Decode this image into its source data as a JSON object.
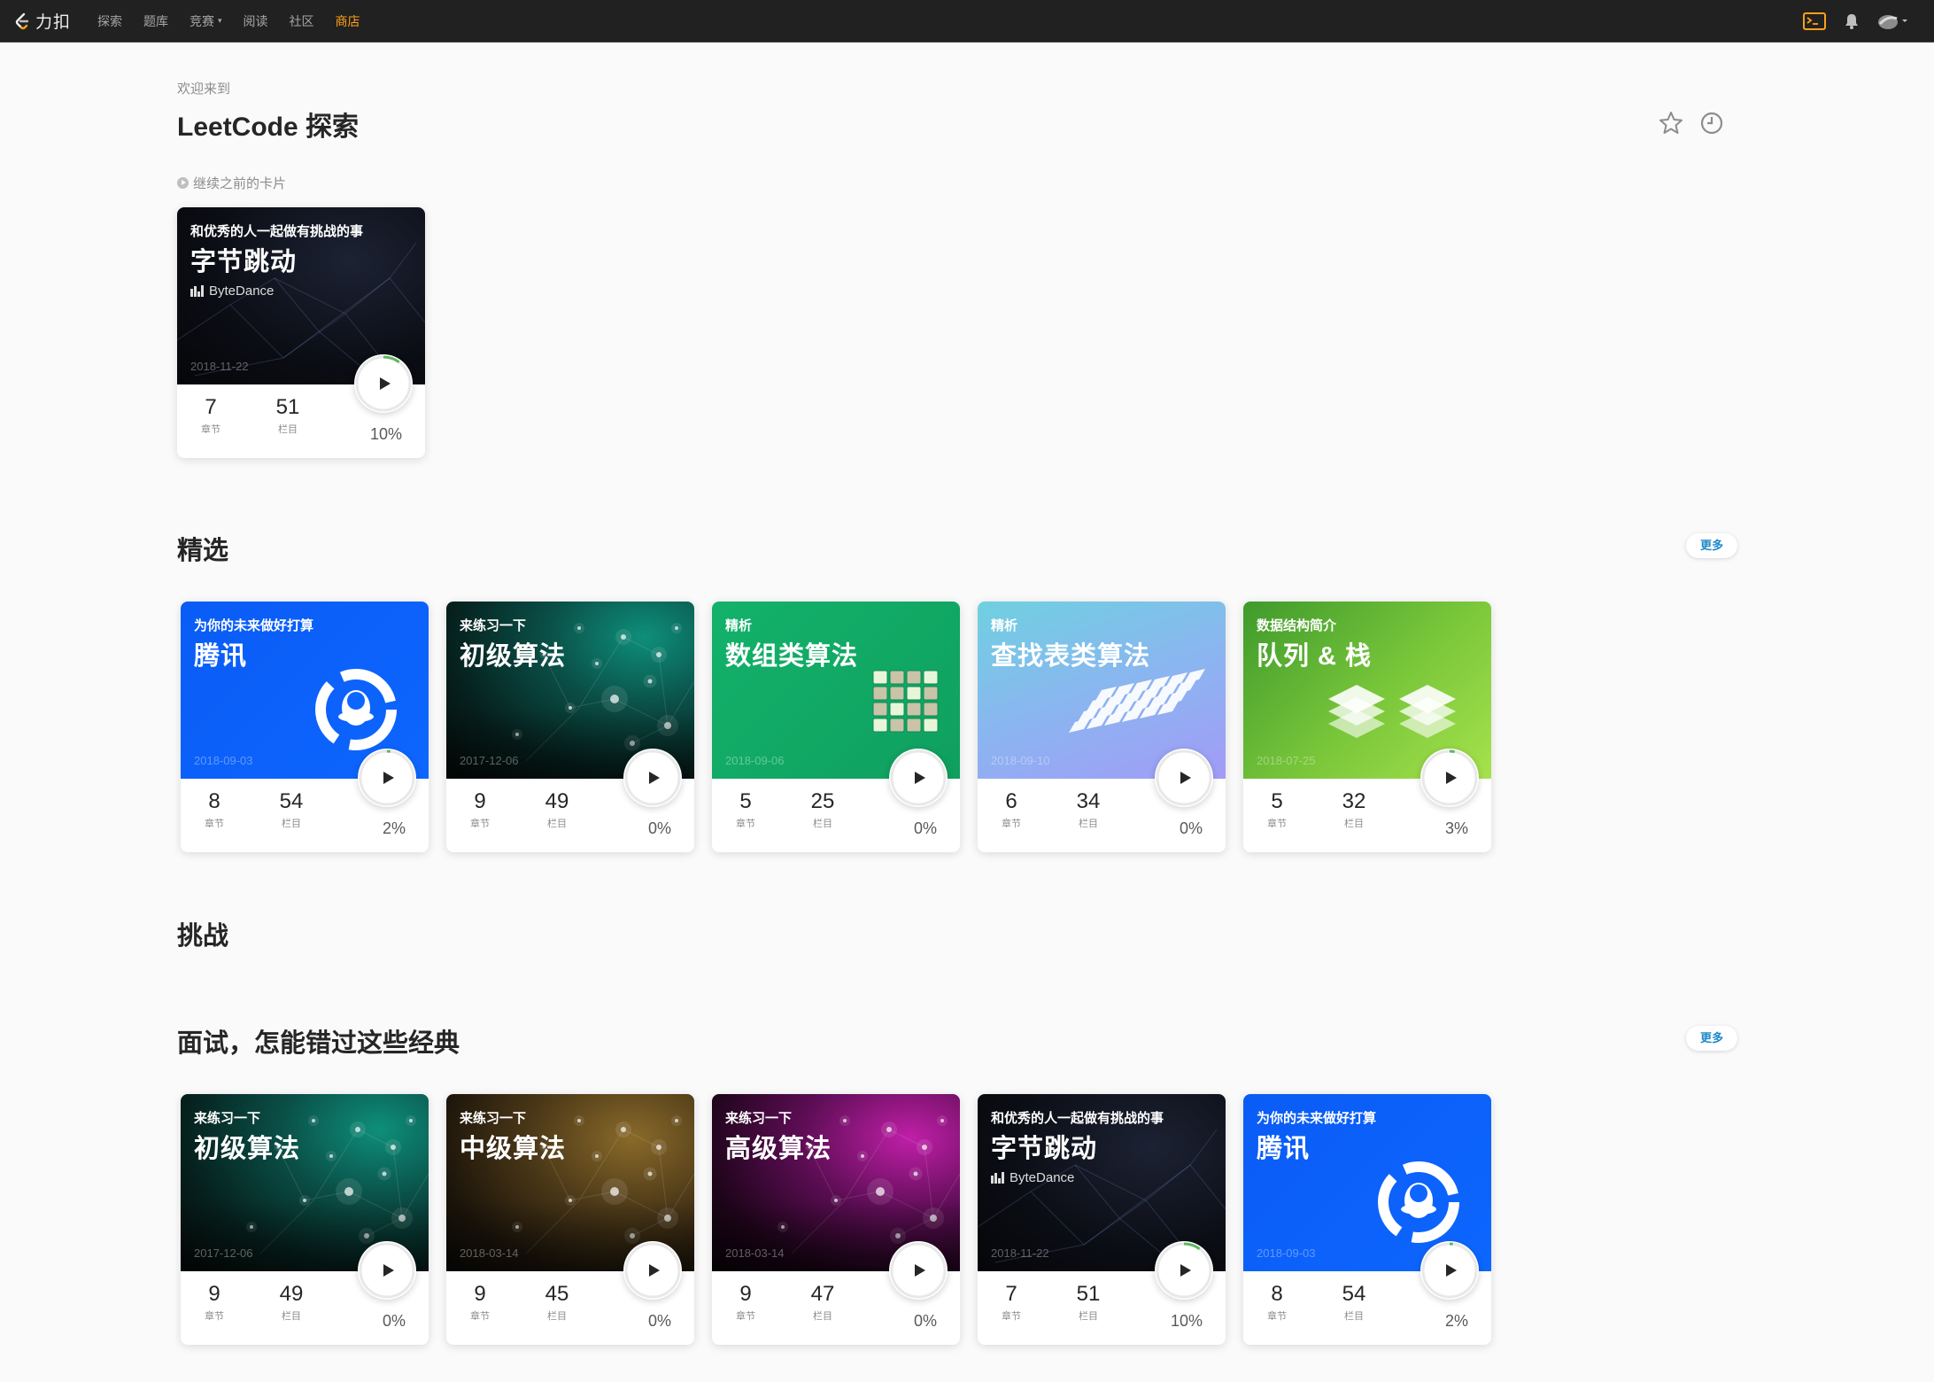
{
  "nav": {
    "logo_text": "力扣",
    "items": [
      {
        "label": "探索",
        "active": false,
        "caret": false
      },
      {
        "label": "题库",
        "active": false,
        "caret": false
      },
      {
        "label": "竞赛",
        "active": false,
        "caret": true
      },
      {
        "label": "阅读",
        "active": false,
        "caret": false
      },
      {
        "label": "社区",
        "active": false,
        "caret": false
      },
      {
        "label": "商店",
        "active": true,
        "caret": false
      }
    ],
    "accent_color": "#ffa116",
    "right_icons": [
      "terminal-icon",
      "bell-icon",
      "avatar-icon"
    ]
  },
  "header": {
    "welcome": "欢迎来到",
    "title": "LeetCode 探索",
    "icons": [
      "star-icon",
      "history-icon"
    ]
  },
  "continue": {
    "label": "继续之前的卡片",
    "card": {
      "sub": "和优秀的人一起做有挑战的事",
      "title": "字节跳动",
      "brand": "ByteDance",
      "date": "2018-11-22",
      "chapters": "7",
      "items": "51",
      "percent": "10%",
      "progress": 0.1,
      "bg": "bytedance",
      "art": "network"
    }
  },
  "labels": {
    "chapters": "章节",
    "items": "栏目",
    "more": "更多"
  },
  "sections": [
    {
      "title": "精选",
      "has_more": true,
      "cards": [
        {
          "sub": "为你的未来做好打算",
          "title": "腾讯",
          "date": "2018-09-03",
          "chapters": "8",
          "items": "54",
          "percent": "2%",
          "progress": 0.02,
          "bg": "tencent",
          "art": "tencent"
        },
        {
          "sub": "来练习一下",
          "title": "初级算法",
          "date": "2017-12-06",
          "chapters": "9",
          "items": "49",
          "percent": "0%",
          "progress": 0,
          "bg": "teal",
          "art": "bokeh"
        },
        {
          "sub": "精析",
          "title": "数组类算法",
          "date": "2018-09-06",
          "chapters": "5",
          "items": "25",
          "percent": "0%",
          "progress": 0,
          "bg": "green",
          "art": "cube"
        },
        {
          "sub": "精析",
          "title": "查找表类算法",
          "date": "2018-09-10",
          "chapters": "6",
          "items": "34",
          "percent": "0%",
          "progress": 0,
          "bg": "lav",
          "art": "grid"
        },
        {
          "sub": "数据结构简介",
          "title": "队列 & 栈",
          "date": "2018-07-25",
          "chapters": "5",
          "items": "32",
          "percent": "3%",
          "progress": 0.03,
          "bg": "lime",
          "art": "layers"
        }
      ]
    },
    {
      "title": "挑战",
      "has_more": false,
      "cards": []
    },
    {
      "title": "面试，怎能错过这些经典",
      "has_more": true,
      "cards": [
        {
          "sub": "来练习一下",
          "title": "初级算法",
          "date": "2017-12-06",
          "chapters": "9",
          "items": "49",
          "percent": "0%",
          "progress": 0,
          "bg": "teal",
          "art": "bokeh"
        },
        {
          "sub": "来练习一下",
          "title": "中级算法",
          "date": "2018-03-14",
          "chapters": "9",
          "items": "45",
          "percent": "0%",
          "progress": 0,
          "bg": "gold",
          "art": "bokeh"
        },
        {
          "sub": "来练习一下",
          "title": "高级算法",
          "date": "2018-03-14",
          "chapters": "9",
          "items": "47",
          "percent": "0%",
          "progress": 0,
          "bg": "magenta",
          "art": "bokeh"
        },
        {
          "sub": "和优秀的人一起做有挑战的事",
          "title": "字节跳动",
          "brand": "ByteDance",
          "date": "2018-11-22",
          "chapters": "7",
          "items": "51",
          "percent": "10%",
          "progress": 0.1,
          "bg": "bytedance",
          "art": "network"
        },
        {
          "sub": "为你的未来做好打算",
          "title": "腾讯",
          "date": "2018-09-03",
          "chapters": "8",
          "items": "54",
          "percent": "2%",
          "progress": 0.02,
          "bg": "tencent",
          "art": "tencent"
        }
      ]
    }
  ]
}
